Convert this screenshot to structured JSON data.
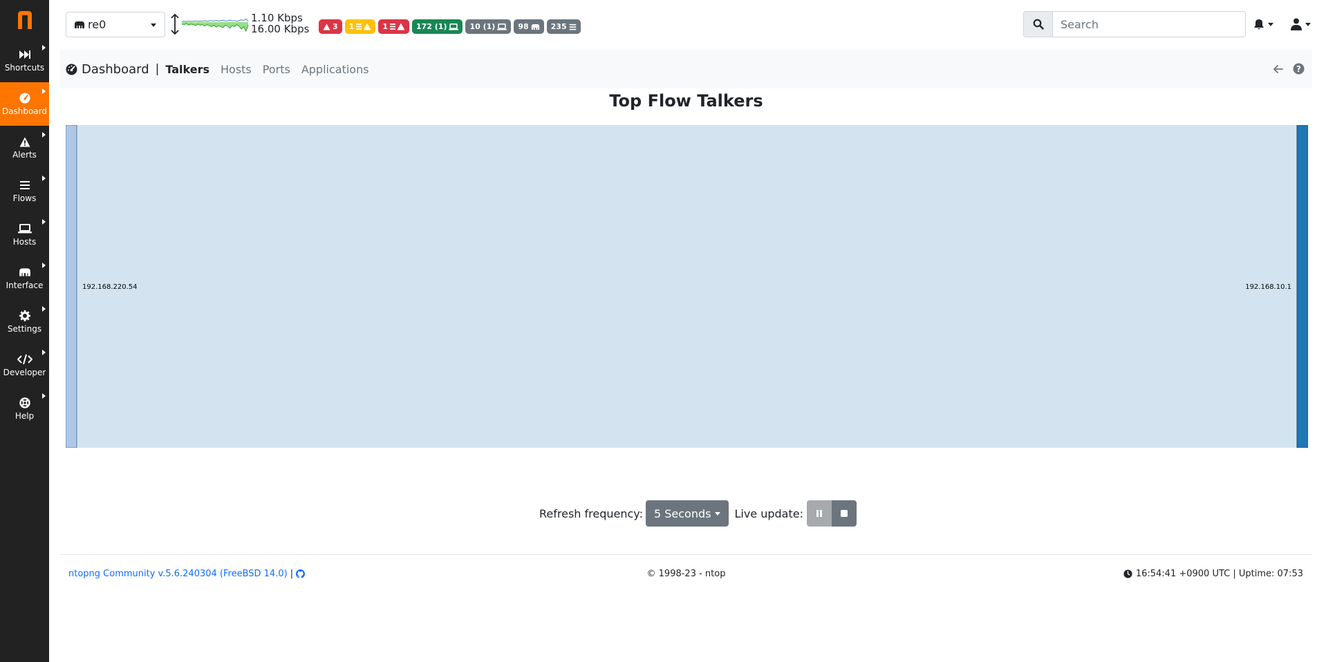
{
  "colors": {
    "sidebar_bg": "#222222",
    "active_orange": "#ff7500",
    "badge_red": "#dc3545",
    "badge_yellow": "#ffc107",
    "badge_green": "#198754",
    "badge_gray": "#6c757d",
    "sankey_link": "#d3e4f0",
    "sankey_node_left": "#aec7e8",
    "sankey_node_right": "#1f77b4",
    "link_blue": "#0d6efd"
  },
  "sidebar": {
    "logo": "n",
    "items": [
      {
        "label": "Shortcuts",
        "icon": "fast-forward-icon"
      },
      {
        "label": "Dashboard",
        "icon": "gauge-icon",
        "active": true
      },
      {
        "label": "Alerts",
        "icon": "warning-icon"
      },
      {
        "label": "Flows",
        "icon": "list-icon"
      },
      {
        "label": "Hosts",
        "icon": "laptop-icon"
      },
      {
        "label": "Interface",
        "icon": "ethernet-icon"
      },
      {
        "label": "Settings",
        "icon": "gear-icon"
      },
      {
        "label": "Developer",
        "icon": "code-icon"
      },
      {
        "label": "Help",
        "icon": "lifebuoy-icon"
      }
    ]
  },
  "topbar": {
    "interface": "re0",
    "throughput_up": "1.10 Kbps",
    "throughput_down": "16.00 Kbps",
    "sparkline_values": [
      4,
      5,
      3,
      6,
      4,
      5,
      7,
      4,
      6,
      5,
      8,
      5,
      7,
      9,
      6,
      10,
      7,
      9,
      11,
      6,
      8,
      12,
      7,
      9,
      5,
      8,
      14,
      9,
      18,
      6
    ],
    "badges": [
      {
        "text": "3",
        "icon": "warning-icon",
        "color": "#dc3545",
        "text_color": "#ffffff",
        "order": "icon-first"
      },
      {
        "text": "1",
        "icon": "list-warning-icon",
        "color": "#ffc107",
        "text_color": "#ffffff",
        "order": "text-first"
      },
      {
        "text": "1",
        "icon": "list-warning-icon",
        "color": "#dc3545",
        "text_color": "#ffffff",
        "order": "text-first"
      },
      {
        "text": "172 (1)",
        "icon": "laptop-icon",
        "color": "#198754",
        "text_color": "#ffffff",
        "order": "text-first"
      },
      {
        "text": "10 (1)",
        "icon": "laptop-icon",
        "color": "#6c757d",
        "text_color": "#ffffff",
        "order": "text-first"
      },
      {
        "text": "98",
        "icon": "ethernet-icon",
        "color": "#6c757d",
        "text_color": "#ffffff",
        "order": "text-first"
      },
      {
        "text": "235",
        "icon": "list-icon",
        "color": "#6c757d",
        "text_color": "#ffffff",
        "order": "text-first"
      }
    ],
    "search_placeholder": "Search"
  },
  "subnav": {
    "title": "Dashboard",
    "separator": "|",
    "tabs": [
      {
        "label": "Talkers",
        "active": true
      },
      {
        "label": "Hosts"
      },
      {
        "label": "Ports"
      },
      {
        "label": "Applications"
      }
    ]
  },
  "main": {
    "title": "Top Flow Talkers",
    "sankey": {
      "source": "192.168.220.54",
      "target": "192.168.10.1"
    }
  },
  "refresh": {
    "label": "Refresh frequency:",
    "value": "5 Seconds",
    "live_label": "Live update:"
  },
  "footer": {
    "version": "ntopng Community v.5.6.240304 (FreeBSD 14.0)",
    "pipe": "|",
    "copyright": "© 1998-23 - ntop",
    "time": "16:54:41 +0900 UTC | Uptime: 07:53"
  }
}
